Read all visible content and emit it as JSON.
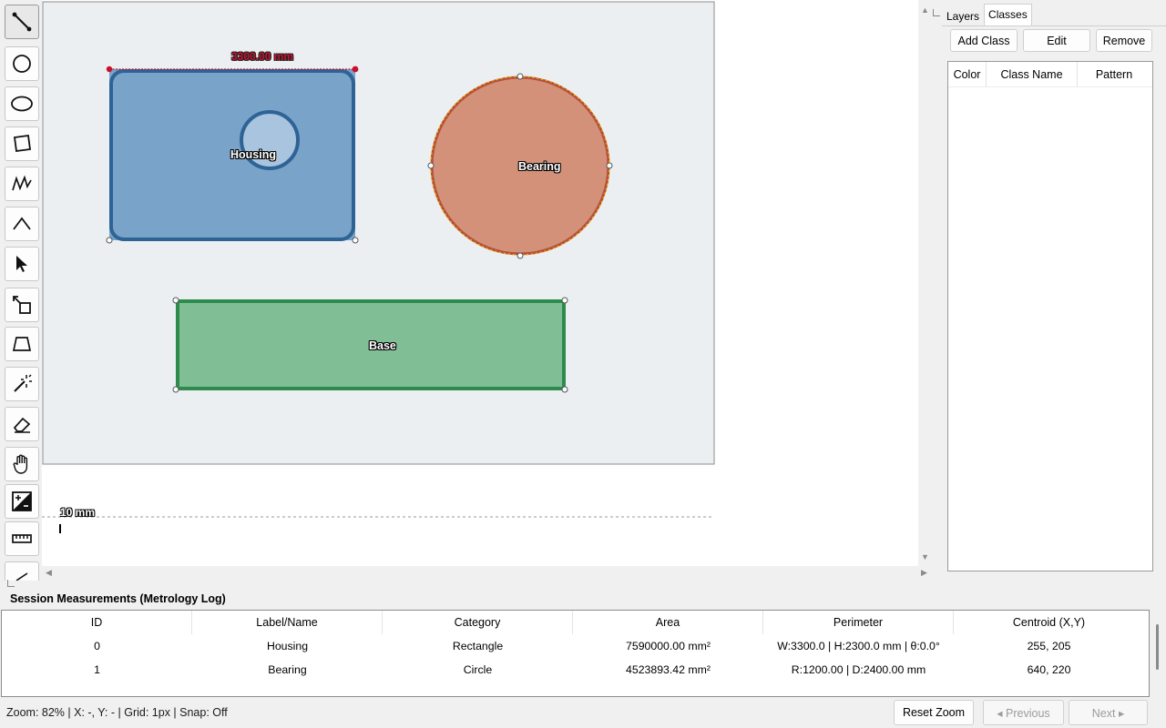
{
  "canvas": {
    "shapes": [
      {
        "name": "Housing"
      },
      {
        "name": "Bearing"
      },
      {
        "name": "Base"
      }
    ],
    "dimension_label": "3300.00 mm",
    "scale_label": "10 mm",
    "colors": {
      "housing_fill": "#79a3c9",
      "housing_stroke": "#2e6396",
      "bearing_fill": "#d4917a",
      "bearing_stroke": "#b5503a",
      "base_fill": "#80bf95",
      "base_stroke": "#2f8a4e",
      "dimension": "#c8102e",
      "canvas_bg": "#eceff2"
    }
  },
  "tools": [
    "line-tool-icon",
    "circle-tool-icon",
    "ellipse-tool-icon",
    "rectangle-tool-icon",
    "polyline-tool-icon",
    "angle-tool-icon",
    "select-pointer-icon",
    "move-tool-icon",
    "perspective-tool-icon",
    "magic-wand-icon",
    "eraser-icon",
    "hand-pan-icon",
    "calibrate-icon",
    "ruler-icon",
    "pen-icon"
  ],
  "right_panel": {
    "tabs": [
      "Layers",
      "Classes"
    ],
    "active_tab": "Classes",
    "buttons": {
      "add": "Add Class",
      "edit": "Edit",
      "remove": "Remove"
    },
    "columns": [
      "Color",
      "Class Name",
      "Pattern"
    ]
  },
  "measurements": {
    "title": "Session Measurements (Metrology Log)",
    "columns": [
      "ID",
      "Label/Name",
      "Category",
      "Area",
      "Perimeter",
      "Centroid (X,Y)"
    ],
    "rows": [
      [
        "0",
        "Housing",
        "Rectangle",
        "7590000.00 mm²",
        "W:3300.0 | H:2300.0 mm | θ:0.0°",
        "255, 205"
      ],
      [
        "1",
        "Bearing",
        "Circle",
        "4523893.42 mm²",
        "R:1200.00 | D:2400.00 mm",
        "640, 220"
      ]
    ]
  },
  "status": {
    "text": "Zoom: 82% | X: -, Y: - | Grid: 1px | Snap: Off",
    "reset_zoom": "Reset Zoom",
    "previous": "◂ Previous",
    "next": "Next ▸"
  }
}
